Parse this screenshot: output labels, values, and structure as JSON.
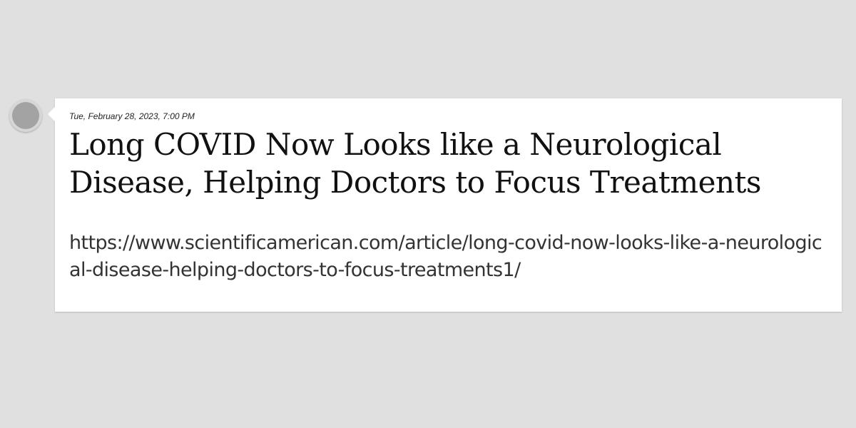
{
  "post": {
    "date": "Tue, February 28, 2023, 7:00 PM",
    "title": "Long COVID Now Looks like a Neurological Disease, Helping Doctors to Focus Treatments",
    "url": "https://www.scientificamerican.com/article/long-covid-now-looks-like-a-neurological-disease-helping-doctors-to-focus-treatments1/"
  },
  "colors": {
    "background": "#e0e0e0",
    "card": "#ffffff",
    "dot": "#a3a3a3",
    "dot_ring": "#d6d6d6"
  }
}
